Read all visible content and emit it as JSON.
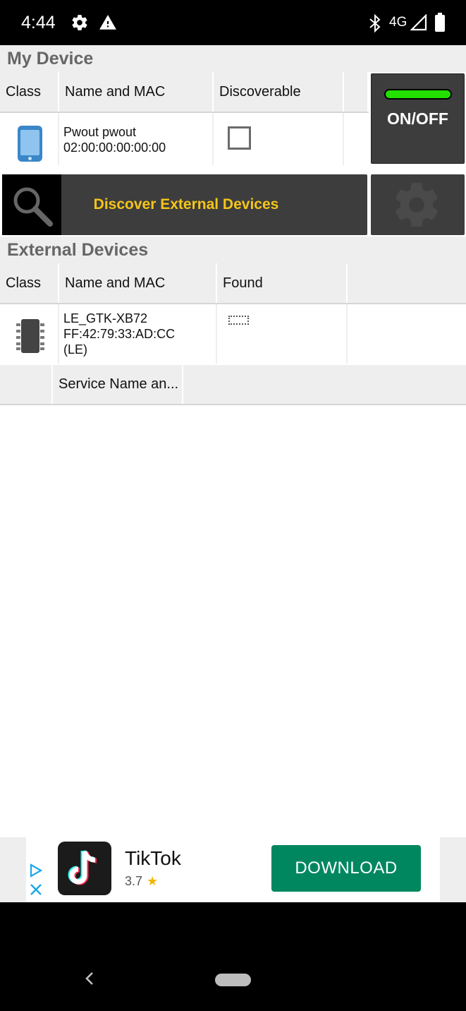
{
  "status_bar": {
    "time": "4:44",
    "network": "4G",
    "icons": [
      "gear-icon",
      "warning-icon",
      "bluetooth-icon",
      "signal-icon",
      "battery-icon"
    ]
  },
  "my_device": {
    "title": "My Device",
    "columns": [
      "Class",
      "Name and MAC",
      "Discoverable"
    ],
    "row": {
      "class_icon": "phone-icon",
      "name": "Pwout pwout",
      "mac": "02:00:00:00:00:00",
      "discoverable": false
    }
  },
  "onoff": {
    "label": "ON/OFF",
    "led_color": "#22e000",
    "state": "on"
  },
  "discover": {
    "label": "Discover External Devices",
    "label_color": "#f5c518"
  },
  "external_devices": {
    "title": "External Devices",
    "columns": [
      "Class",
      "Name and MAC",
      "Found"
    ],
    "rows": [
      {
        "class_icon": "chip-icon",
        "name": "LE_GTK-XB72",
        "mac": "FF:42:79:33:AD:CC",
        "type": "(LE)",
        "found_icon": "dotted-box-icon"
      }
    ]
  },
  "services": {
    "columns": [
      "",
      "Service Name an..."
    ]
  },
  "ad": {
    "app_name": "TikTok",
    "rating": "3.7",
    "button": "DOWNLOAD",
    "button_color": "#01875f"
  }
}
